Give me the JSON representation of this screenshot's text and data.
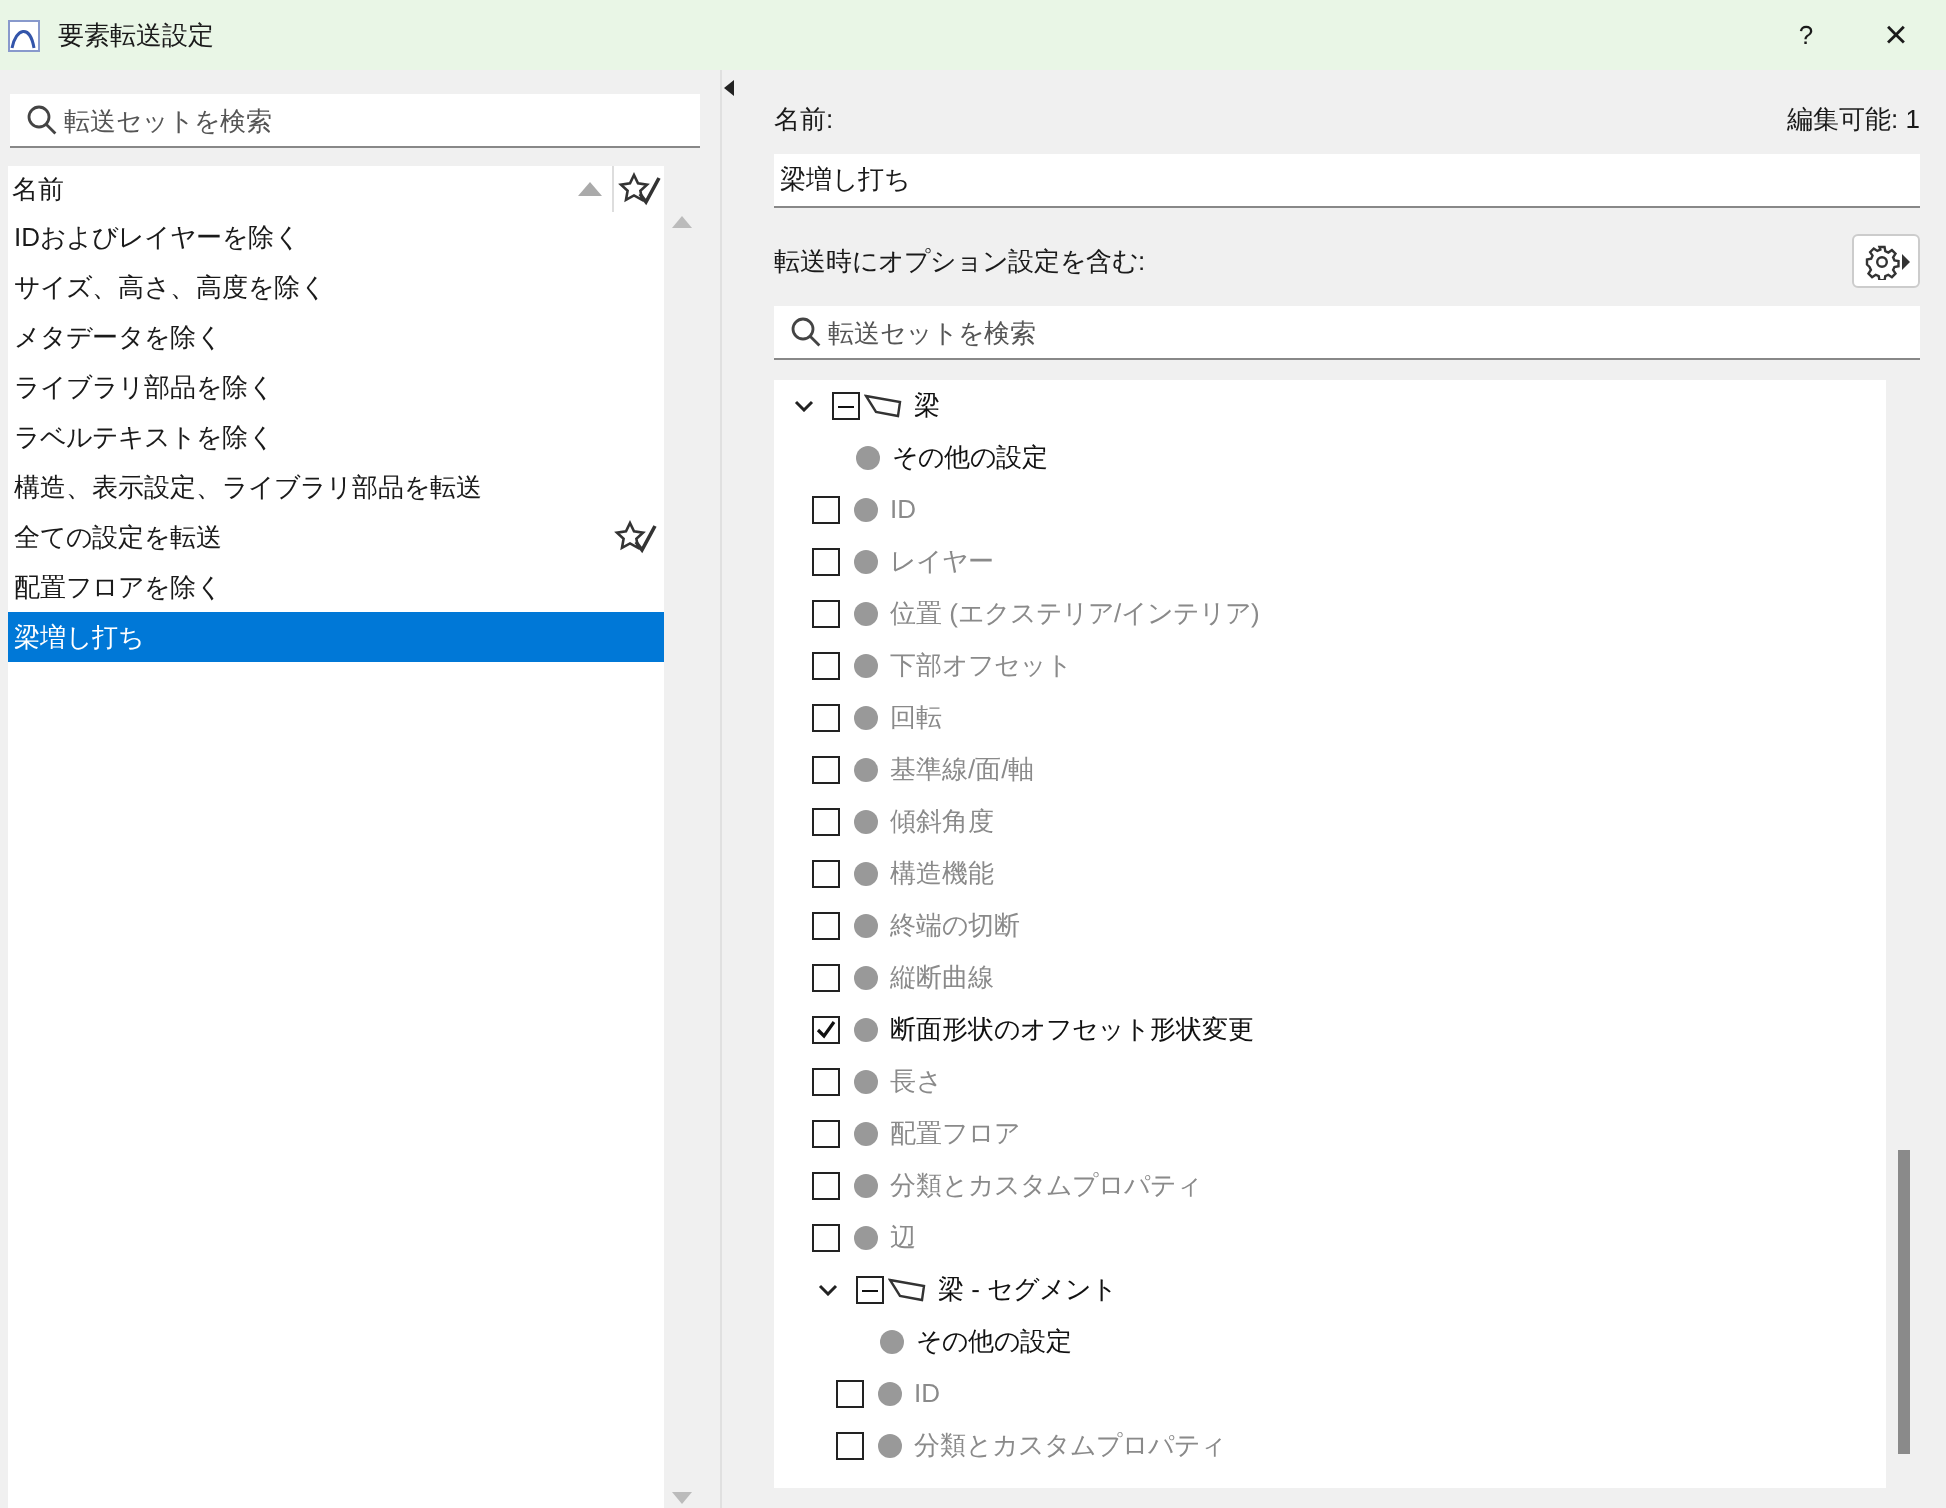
{
  "window": {
    "title": "要素転送設定",
    "help": "?",
    "close": "×"
  },
  "left": {
    "search": {
      "placeholder": "転送セットを検索"
    },
    "column": "名前",
    "sets": [
      {
        "label": "IDおよびレイヤーを除く",
        "favorite": false,
        "selected": false
      },
      {
        "label": "サイズ、高さ、高度を除く",
        "favorite": false,
        "selected": false
      },
      {
        "label": "メタデータを除く",
        "favorite": false,
        "selected": false
      },
      {
        "label": "ライブラリ部品を除く",
        "favorite": false,
        "selected": false
      },
      {
        "label": "ラベルテキストを除く",
        "favorite": false,
        "selected": false
      },
      {
        "label": "構造、表示設定、ライブラリ部品を転送",
        "favorite": false,
        "selected": false
      },
      {
        "label": "全ての設定を転送",
        "favorite": true,
        "selected": false
      },
      {
        "label": "配置フロアを除く",
        "favorite": false,
        "selected": false
      },
      {
        "label": "梁増し打ち",
        "favorite": false,
        "selected": true
      }
    ]
  },
  "right": {
    "name_label": "名前:",
    "editable": "編集可能: 1",
    "name_value": "梁増し打ち",
    "options_label": "転送時にオプション設定を含む:",
    "search": {
      "placeholder": "転送セットを検索"
    },
    "tree": [
      {
        "kind": "group",
        "label": "梁",
        "expanded": true,
        "partial": true,
        "children": [
          {
            "kind": "other",
            "label": "その他の設定"
          },
          {
            "kind": "option",
            "label": "ID",
            "checked": false
          },
          {
            "kind": "option",
            "label": "レイヤー",
            "checked": false
          },
          {
            "kind": "option",
            "label": "位置 (エクステリア/インテリア)",
            "checked": false
          },
          {
            "kind": "option",
            "label": "下部オフセット",
            "checked": false
          },
          {
            "kind": "option",
            "label": "回転",
            "checked": false
          },
          {
            "kind": "option",
            "label": "基準線/面/軸",
            "checked": false
          },
          {
            "kind": "option",
            "label": "傾斜角度",
            "checked": false
          },
          {
            "kind": "option",
            "label": "構造機能",
            "checked": false
          },
          {
            "kind": "option",
            "label": "終端の切断",
            "checked": false
          },
          {
            "kind": "option",
            "label": "縦断曲線",
            "checked": false
          },
          {
            "kind": "option",
            "label": "断面形状のオフセット形状変更",
            "checked": true
          },
          {
            "kind": "option",
            "label": "長さ",
            "checked": false
          },
          {
            "kind": "option",
            "label": "配置フロア",
            "checked": false
          },
          {
            "kind": "option",
            "label": "分類とカスタムプロパティ",
            "checked": false
          },
          {
            "kind": "option",
            "label": "辺",
            "checked": false
          },
          {
            "kind": "group",
            "label": "梁 - セグメント",
            "expanded": true,
            "partial": true,
            "children": [
              {
                "kind": "other",
                "label": "その他の設定"
              },
              {
                "kind": "option",
                "label": "ID",
                "checked": false
              },
              {
                "kind": "option",
                "label": "分類とカスタムプロパティ",
                "checked": false
              }
            ]
          }
        ]
      }
    ]
  }
}
